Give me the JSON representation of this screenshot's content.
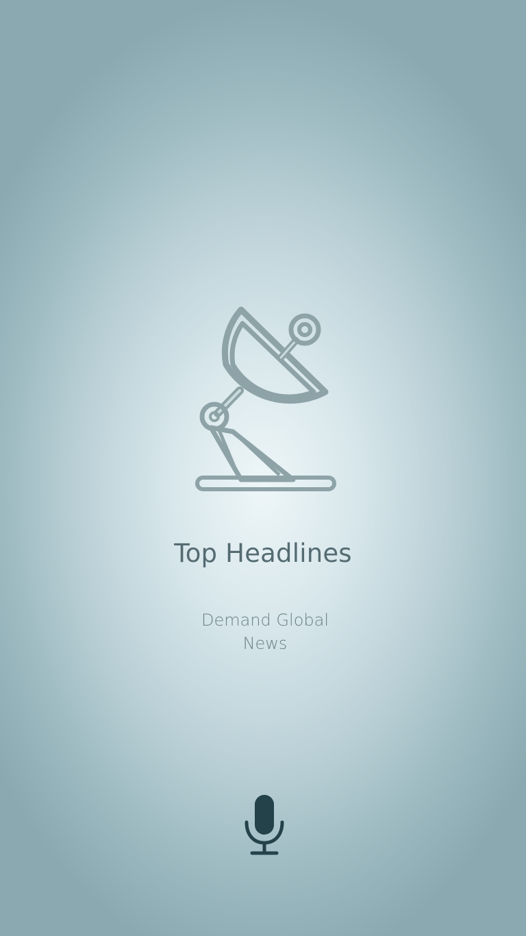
{
  "icons": {
    "hero": "satellite-dish-icon",
    "mic": "microphone-icon"
  },
  "colors": {
    "icon_outline": "#8ea3a7",
    "title_text": "#546b72",
    "subtitle_text": "#6c8087",
    "mic": "#23424a"
  },
  "main": {
    "title": "Top Headlines",
    "subtitle": "Demand Global News"
  }
}
